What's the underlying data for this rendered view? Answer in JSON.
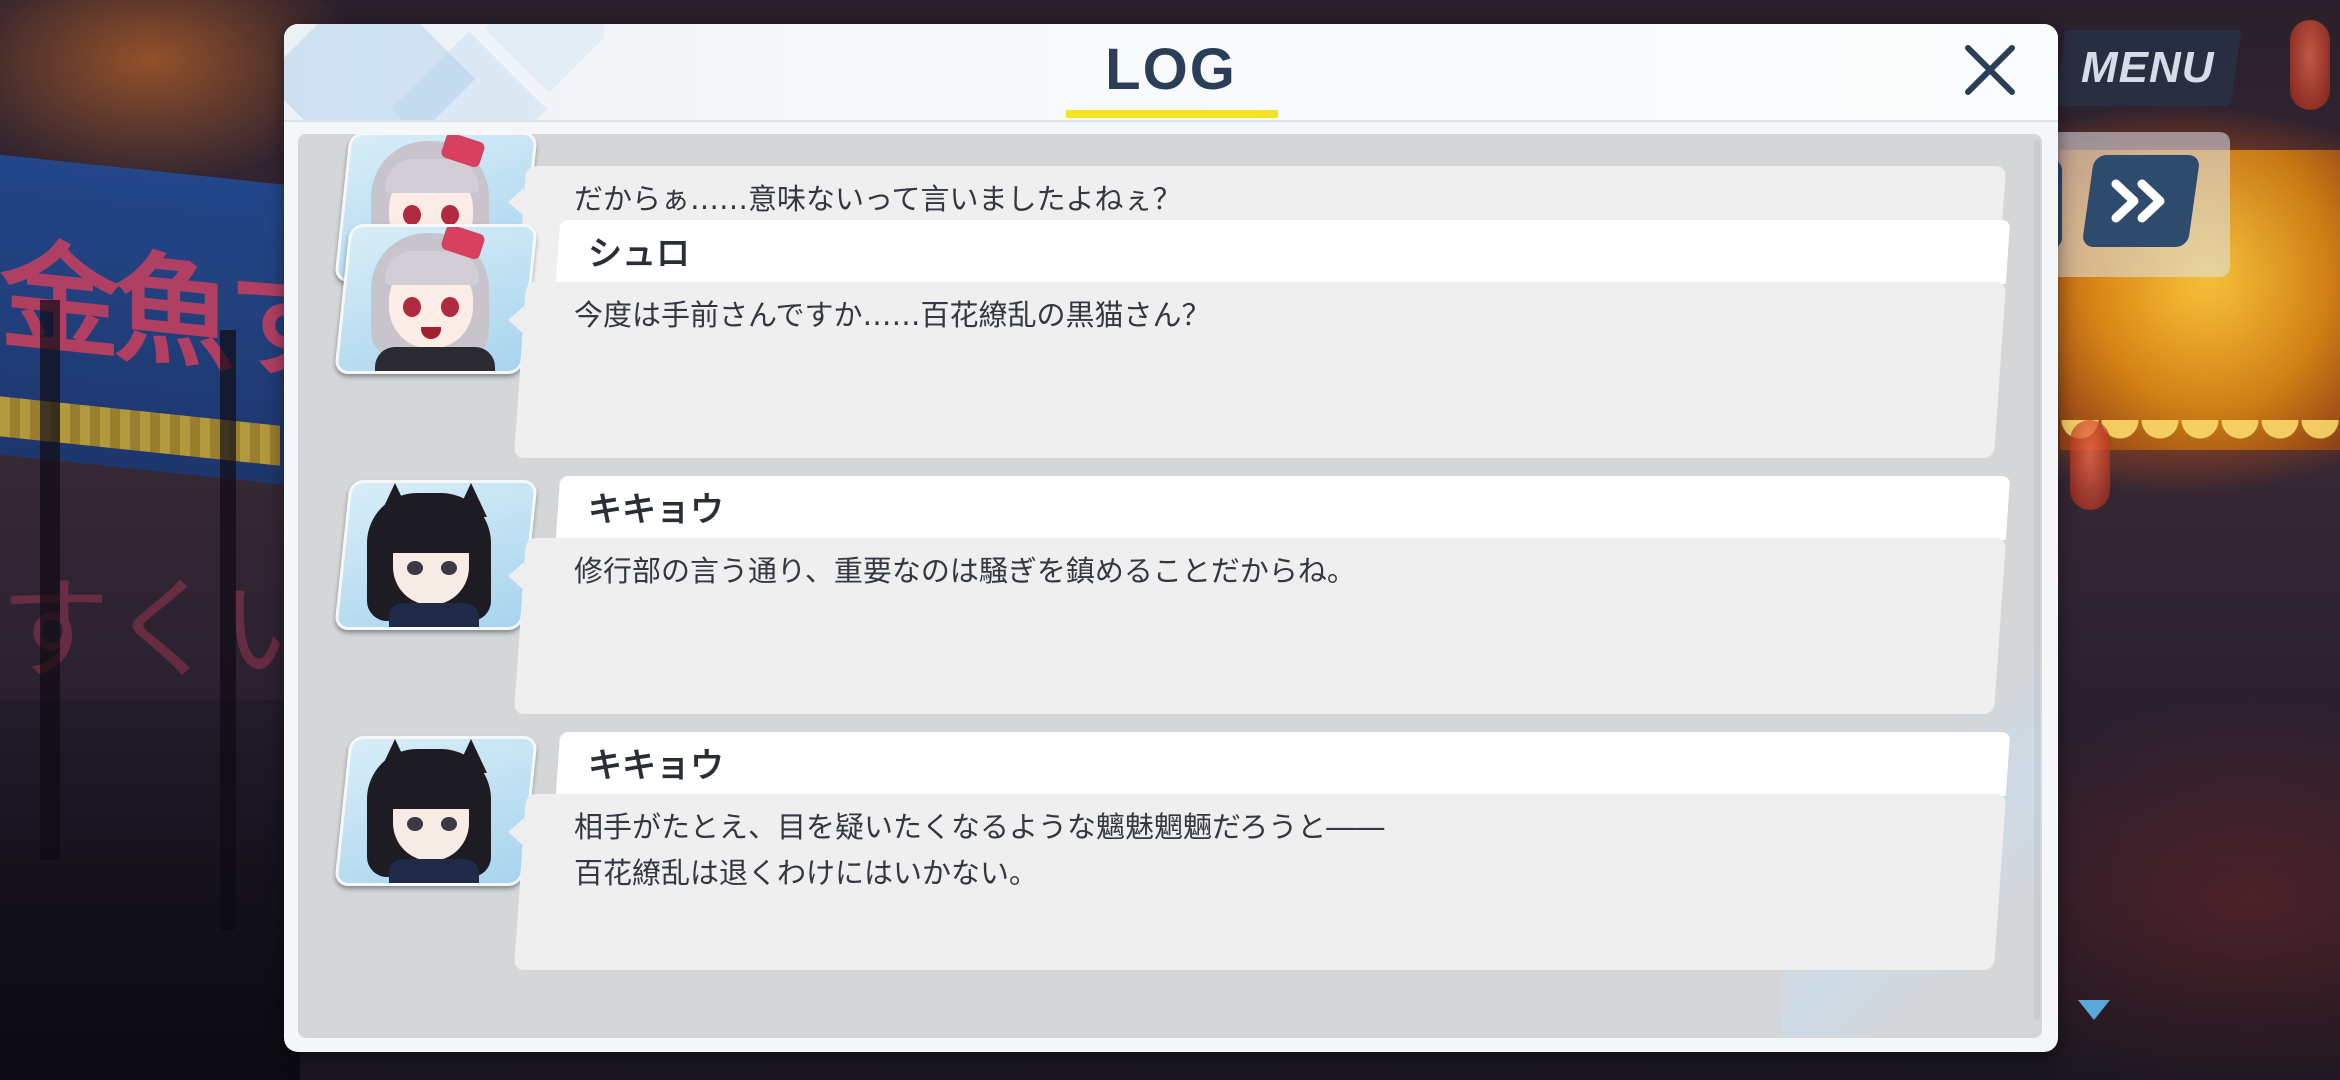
{
  "hud": {
    "menu_label": "MENU",
    "fast_forward_icon": "fast-forward-icon",
    "next_indicator_icon": "triangle-down-icon"
  },
  "log": {
    "title": "LOG",
    "close_icon": "close-icon",
    "entries": [
      {
        "speaker": "",
        "portrait": "shiro-portrait",
        "lines": [
          "だからぁ……意味ないって言いましたよねぇ？"
        ]
      },
      {
        "speaker": "シュロ",
        "portrait": "shiro-portrait",
        "lines": [
          "今度は手前さんですか……百花繚乱の黒猫さん？"
        ]
      },
      {
        "speaker": "キキョウ",
        "portrait": "kikyou-portrait",
        "lines": [
          "修行部の言う通り、重要なのは騒ぎを鎮めることだからね。"
        ]
      },
      {
        "speaker": "キキョウ",
        "portrait": "kikyou-portrait",
        "lines": [
          "相手がたとえ、目を疑いたくなるような魑魅魍魎だろうと――",
          "百花繚乱は退くわけにはいかない。"
        ]
      }
    ]
  },
  "colors": {
    "title_text": "#2b3e58",
    "title_underline": "#f4e423",
    "button_navy": "#2e4a6c"
  }
}
